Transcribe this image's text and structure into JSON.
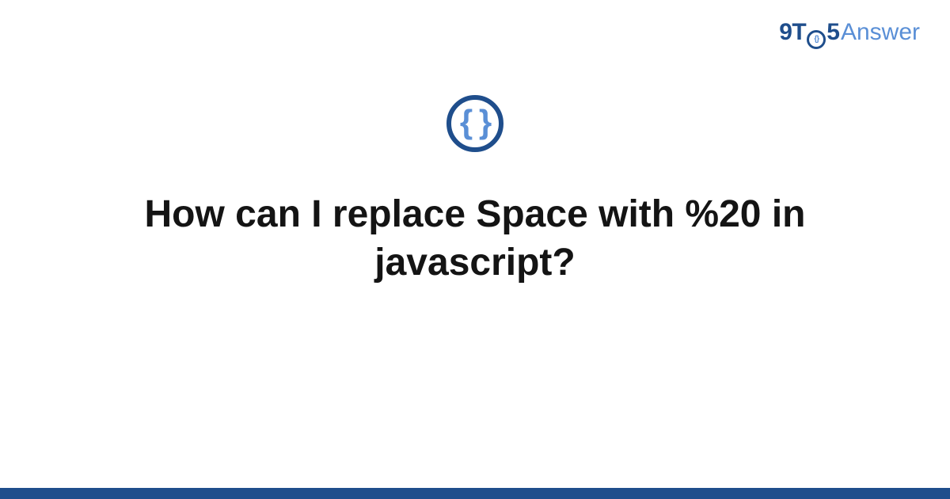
{
  "logo": {
    "part1": "9T",
    "o_inner": "{}",
    "part2": "5",
    "part3": "Answer"
  },
  "badge": {
    "glyph": "{ }"
  },
  "title": "How can I replace Space with %20 in javascript?",
  "colors": {
    "primary": "#1f4e8c",
    "accent": "#5a8fd6"
  }
}
